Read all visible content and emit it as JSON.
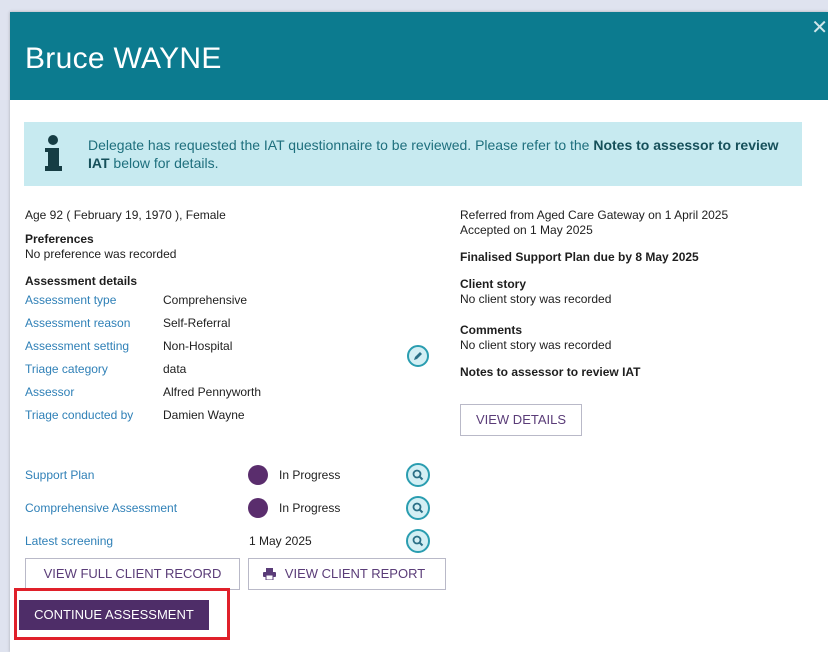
{
  "header": {
    "title": "Bruce WAYNE",
    "close_symbol": "✕",
    "color": "#0c7b8f"
  },
  "banner": {
    "text_before": "Delegate has requested the IAT questionnaire to be reviewed. Please refer to the ",
    "text_bold": "Notes to assessor to review IAT",
    "text_after": " below for details.",
    "icon": "info-icon",
    "color": "#c7eaf0"
  },
  "left": {
    "age_line": "Age 92 ( February 19, 1970 ), Female",
    "preferences_heading": "Preferences",
    "preferences_value": "No preference was recorded",
    "assessment_heading": "Assessment details",
    "details": [
      {
        "label": "Assessment type",
        "value": "Comprehensive"
      },
      {
        "label": "Assessment reason",
        "value": "Self-Referral"
      },
      {
        "label": "Assessment setting",
        "value": "Non-Hospital"
      },
      {
        "label": "Triage category",
        "value": "data"
      },
      {
        "label": "Assessor",
        "value": "Alfred Pennyworth"
      },
      {
        "label": "Triage conducted by",
        "value": "Damien Wayne"
      }
    ],
    "statuses": [
      {
        "label": "Support Plan",
        "value": "In Progress",
        "icon": "status-dot"
      },
      {
        "label": "Comprehensive Assessment",
        "value": "In Progress",
        "icon": "status-dot"
      },
      {
        "label": "Latest screening",
        "value": "1 May 2025"
      }
    ]
  },
  "right": {
    "referred": "Referred from Aged Care Gateway on 1 April 2025",
    "accepted": "Accepted on 1 May 2025",
    "support_plan_due": "Finalised Support Plan due by 8 May 2025",
    "client_story_heading": "Client story",
    "client_story_value": "No client story was recorded",
    "comments_heading": "Comments",
    "comments_value": "No client story was recorded",
    "notes_heading": "Notes to assessor to review IAT",
    "view_details": "VIEW DETAILS"
  },
  "buttons": {
    "view_full_record": "VIEW FULL CLIENT RECORD",
    "view_report": "VIEW CLIENT REPORT",
    "continue": "CONTINUE ASSESSMENT"
  },
  "colors": {
    "primary": "#4e2d68",
    "link": "#2f80b7",
    "highlight": "#e0202a"
  }
}
